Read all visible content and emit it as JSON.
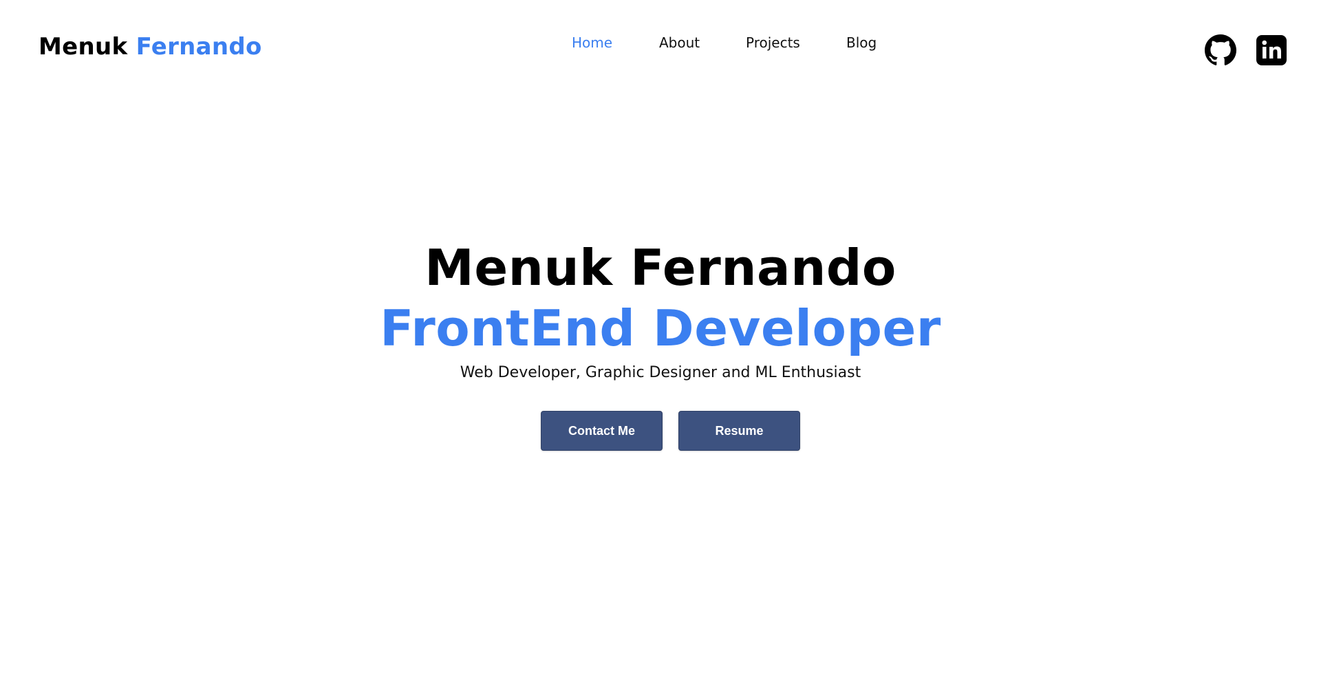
{
  "header": {
    "logo": {
      "first": "Menuk",
      "last": "Fernando"
    },
    "nav": [
      {
        "label": "Home",
        "active": true
      },
      {
        "label": "About",
        "active": false
      },
      {
        "label": "Projects",
        "active": false
      },
      {
        "label": "Blog",
        "active": false
      }
    ],
    "social": [
      {
        "icon": "github-icon"
      },
      {
        "icon": "linkedin-icon"
      }
    ]
  },
  "hero": {
    "name": "Menuk Fernando",
    "role": "FrontEnd Developer",
    "tagline": "Web Developer, Graphic Designer and ML Enthusiast",
    "buttons": {
      "contact_label": "Contact Me",
      "resume_label": "Resume"
    }
  },
  "colors": {
    "accent": "#3b7ff0",
    "button": "#3d5280",
    "text": "#000000",
    "background": "#ffffff"
  }
}
